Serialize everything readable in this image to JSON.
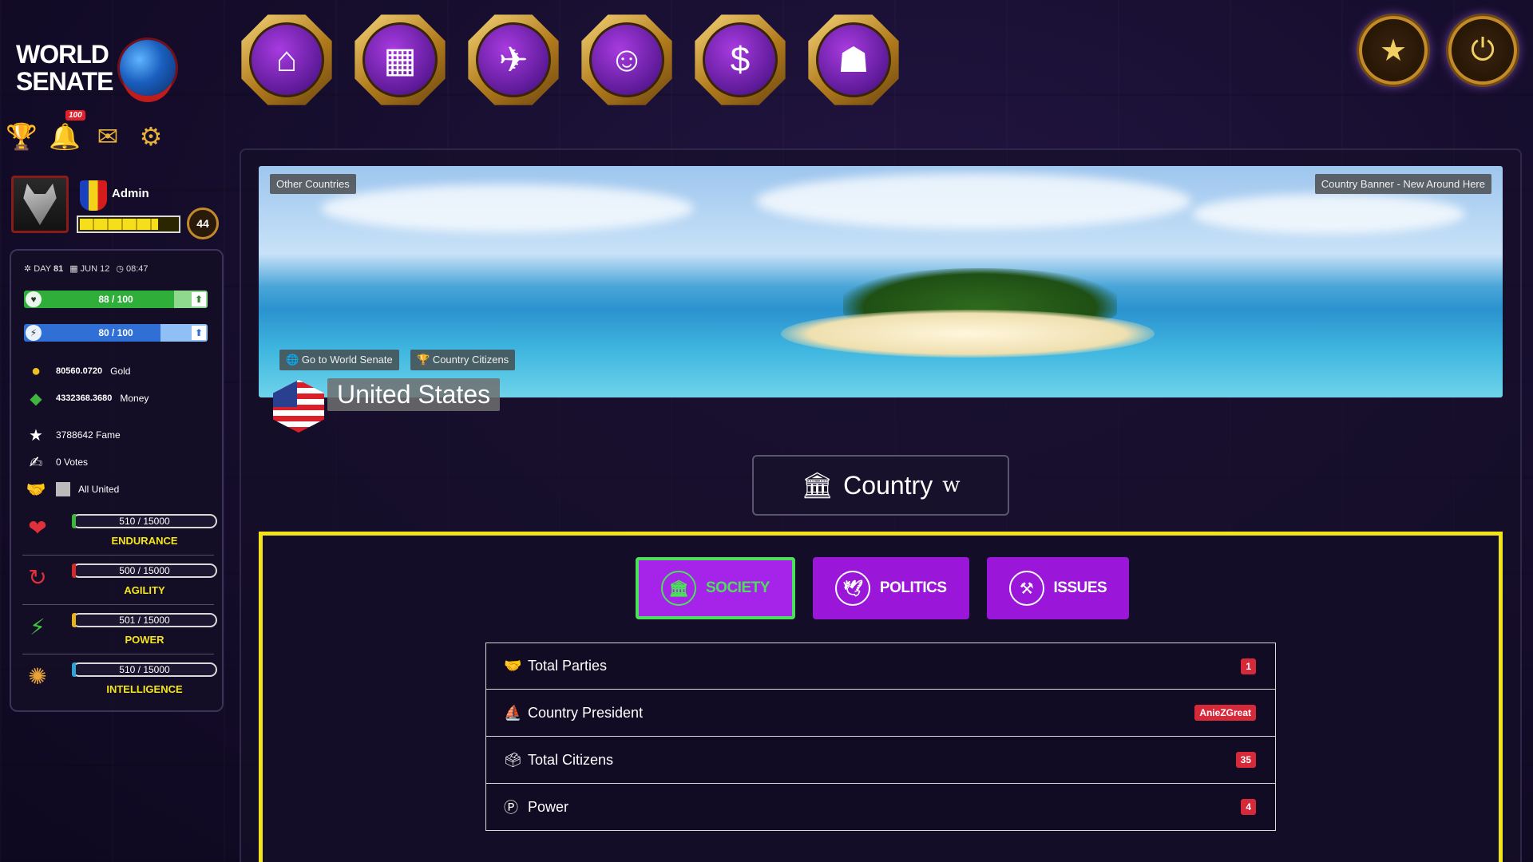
{
  "app": {
    "logo_line1": "WORLD",
    "logo_line2": "SENATE"
  },
  "mini_icons": [
    {
      "name": "trophy-icon",
      "glyph": "🏆"
    },
    {
      "name": "bell-icon",
      "glyph": "🔔",
      "badge": "100"
    },
    {
      "name": "mail-icon",
      "glyph": "✉"
    },
    {
      "name": "gear-icon",
      "glyph": "⚙"
    }
  ],
  "user": {
    "name": "Admin",
    "level": "44",
    "xp_fraction": 0.8
  },
  "status": {
    "day_label": "DAY",
    "day": "81",
    "date": "JUN 12",
    "time": "08:47"
  },
  "bars": {
    "health": {
      "text": "88 / 100",
      "value": 88,
      "max": 100
    },
    "energy": {
      "text": "80 / 100",
      "value": 80,
      "max": 100
    }
  },
  "resources": {
    "gold_value": "80560.0720",
    "gold_label": "Gold",
    "money_value": "4332368.3680",
    "money_label": "Money",
    "fame": "3788642 Fame",
    "votes": "0 Votes",
    "party": "All United"
  },
  "attributes": [
    {
      "label": "ENDURANCE",
      "text": "510 / 15000",
      "value": 510,
      "max": 15000
    },
    {
      "label": "AGILITY",
      "text": "500 / 15000",
      "value": 500,
      "max": 15000
    },
    {
      "label": "POWER",
      "text": "501 / 15000",
      "value": 501,
      "max": 15000
    },
    {
      "label": "INTELLIGENCE",
      "text": "510 / 15000",
      "value": 510,
      "max": 15000
    }
  ],
  "nav": [
    {
      "name": "home-icon",
      "glyph": "⌂"
    },
    {
      "name": "building-icon",
      "glyph": "▦"
    },
    {
      "name": "airplane-icon",
      "glyph": "✈"
    },
    {
      "name": "astronaut-icon",
      "glyph": "☺"
    },
    {
      "name": "hand-dollar-icon",
      "glyph": "$"
    },
    {
      "name": "group-icon",
      "glyph": "☗"
    }
  ],
  "top_right": [
    {
      "name": "star-medal-icon",
      "glyph": "★"
    },
    {
      "name": "power-icon",
      "glyph": "⏻"
    }
  ],
  "banner": {
    "other_countries": "Other Countries",
    "banner_caption": "Country Banner - New Around Here",
    "go_world_senate": "Go to World Senate",
    "country_citizens": "Country Citizens",
    "country_name": "United States"
  },
  "section": {
    "title": "Country",
    "suffix": "w"
  },
  "tabs": [
    {
      "label": "SOCIETY",
      "icon": "🏛",
      "active": true
    },
    {
      "label": "POLITICS",
      "icon": "🕊",
      "active": false
    },
    {
      "label": "ISSUES",
      "icon": "⚒",
      "active": false
    }
  ],
  "info": [
    {
      "label": "Total Parties",
      "value": "1",
      "icon": "🤝"
    },
    {
      "label": "Country President",
      "value": "AnieZGreat",
      "icon": "⛵"
    },
    {
      "label": "Total Citizens",
      "value": "35",
      "icon": "🗳"
    },
    {
      "label": "Power",
      "value": "4",
      "icon": "Ⓟ"
    }
  ]
}
